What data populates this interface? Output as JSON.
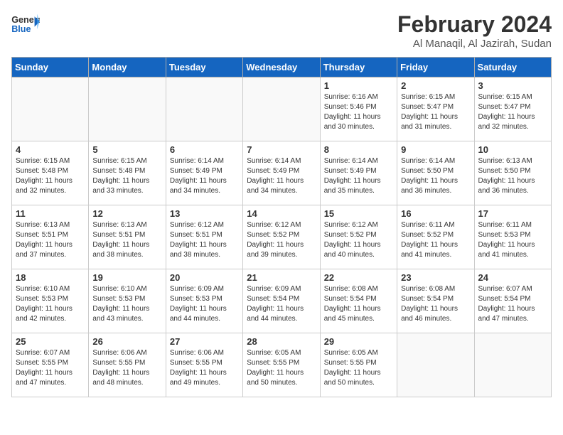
{
  "header": {
    "logo_line1": "General",
    "logo_line2": "Blue",
    "month": "February 2024",
    "location": "Al Manaqil, Al Jazirah, Sudan"
  },
  "days_of_week": [
    "Sunday",
    "Monday",
    "Tuesday",
    "Wednesday",
    "Thursday",
    "Friday",
    "Saturday"
  ],
  "weeks": [
    [
      {
        "day": "",
        "info": ""
      },
      {
        "day": "",
        "info": ""
      },
      {
        "day": "",
        "info": ""
      },
      {
        "day": "",
        "info": ""
      },
      {
        "day": "1",
        "info": "Sunrise: 6:16 AM\nSunset: 5:46 PM\nDaylight: 11 hours and 30 minutes."
      },
      {
        "day": "2",
        "info": "Sunrise: 6:15 AM\nSunset: 5:47 PM\nDaylight: 11 hours and 31 minutes."
      },
      {
        "day": "3",
        "info": "Sunrise: 6:15 AM\nSunset: 5:47 PM\nDaylight: 11 hours and 32 minutes."
      }
    ],
    [
      {
        "day": "4",
        "info": "Sunrise: 6:15 AM\nSunset: 5:48 PM\nDaylight: 11 hours and 32 minutes."
      },
      {
        "day": "5",
        "info": "Sunrise: 6:15 AM\nSunset: 5:48 PM\nDaylight: 11 hours and 33 minutes."
      },
      {
        "day": "6",
        "info": "Sunrise: 6:14 AM\nSunset: 5:49 PM\nDaylight: 11 hours and 34 minutes."
      },
      {
        "day": "7",
        "info": "Sunrise: 6:14 AM\nSunset: 5:49 PM\nDaylight: 11 hours and 34 minutes."
      },
      {
        "day": "8",
        "info": "Sunrise: 6:14 AM\nSunset: 5:49 PM\nDaylight: 11 hours and 35 minutes."
      },
      {
        "day": "9",
        "info": "Sunrise: 6:14 AM\nSunset: 5:50 PM\nDaylight: 11 hours and 36 minutes."
      },
      {
        "day": "10",
        "info": "Sunrise: 6:13 AM\nSunset: 5:50 PM\nDaylight: 11 hours and 36 minutes."
      }
    ],
    [
      {
        "day": "11",
        "info": "Sunrise: 6:13 AM\nSunset: 5:51 PM\nDaylight: 11 hours and 37 minutes."
      },
      {
        "day": "12",
        "info": "Sunrise: 6:13 AM\nSunset: 5:51 PM\nDaylight: 11 hours and 38 minutes."
      },
      {
        "day": "13",
        "info": "Sunrise: 6:12 AM\nSunset: 5:51 PM\nDaylight: 11 hours and 38 minutes."
      },
      {
        "day": "14",
        "info": "Sunrise: 6:12 AM\nSunset: 5:52 PM\nDaylight: 11 hours and 39 minutes."
      },
      {
        "day": "15",
        "info": "Sunrise: 6:12 AM\nSunset: 5:52 PM\nDaylight: 11 hours and 40 minutes."
      },
      {
        "day": "16",
        "info": "Sunrise: 6:11 AM\nSunset: 5:52 PM\nDaylight: 11 hours and 41 minutes."
      },
      {
        "day": "17",
        "info": "Sunrise: 6:11 AM\nSunset: 5:53 PM\nDaylight: 11 hours and 41 minutes."
      }
    ],
    [
      {
        "day": "18",
        "info": "Sunrise: 6:10 AM\nSunset: 5:53 PM\nDaylight: 11 hours and 42 minutes."
      },
      {
        "day": "19",
        "info": "Sunrise: 6:10 AM\nSunset: 5:53 PM\nDaylight: 11 hours and 43 minutes."
      },
      {
        "day": "20",
        "info": "Sunrise: 6:09 AM\nSunset: 5:53 PM\nDaylight: 11 hours and 44 minutes."
      },
      {
        "day": "21",
        "info": "Sunrise: 6:09 AM\nSunset: 5:54 PM\nDaylight: 11 hours and 44 minutes."
      },
      {
        "day": "22",
        "info": "Sunrise: 6:08 AM\nSunset: 5:54 PM\nDaylight: 11 hours and 45 minutes."
      },
      {
        "day": "23",
        "info": "Sunrise: 6:08 AM\nSunset: 5:54 PM\nDaylight: 11 hours and 46 minutes."
      },
      {
        "day": "24",
        "info": "Sunrise: 6:07 AM\nSunset: 5:54 PM\nDaylight: 11 hours and 47 minutes."
      }
    ],
    [
      {
        "day": "25",
        "info": "Sunrise: 6:07 AM\nSunset: 5:55 PM\nDaylight: 11 hours and 47 minutes."
      },
      {
        "day": "26",
        "info": "Sunrise: 6:06 AM\nSunset: 5:55 PM\nDaylight: 11 hours and 48 minutes."
      },
      {
        "day": "27",
        "info": "Sunrise: 6:06 AM\nSunset: 5:55 PM\nDaylight: 11 hours and 49 minutes."
      },
      {
        "day": "28",
        "info": "Sunrise: 6:05 AM\nSunset: 5:55 PM\nDaylight: 11 hours and 50 minutes."
      },
      {
        "day": "29",
        "info": "Sunrise: 6:05 AM\nSunset: 5:55 PM\nDaylight: 11 hours and 50 minutes."
      },
      {
        "day": "",
        "info": ""
      },
      {
        "day": "",
        "info": ""
      }
    ]
  ]
}
